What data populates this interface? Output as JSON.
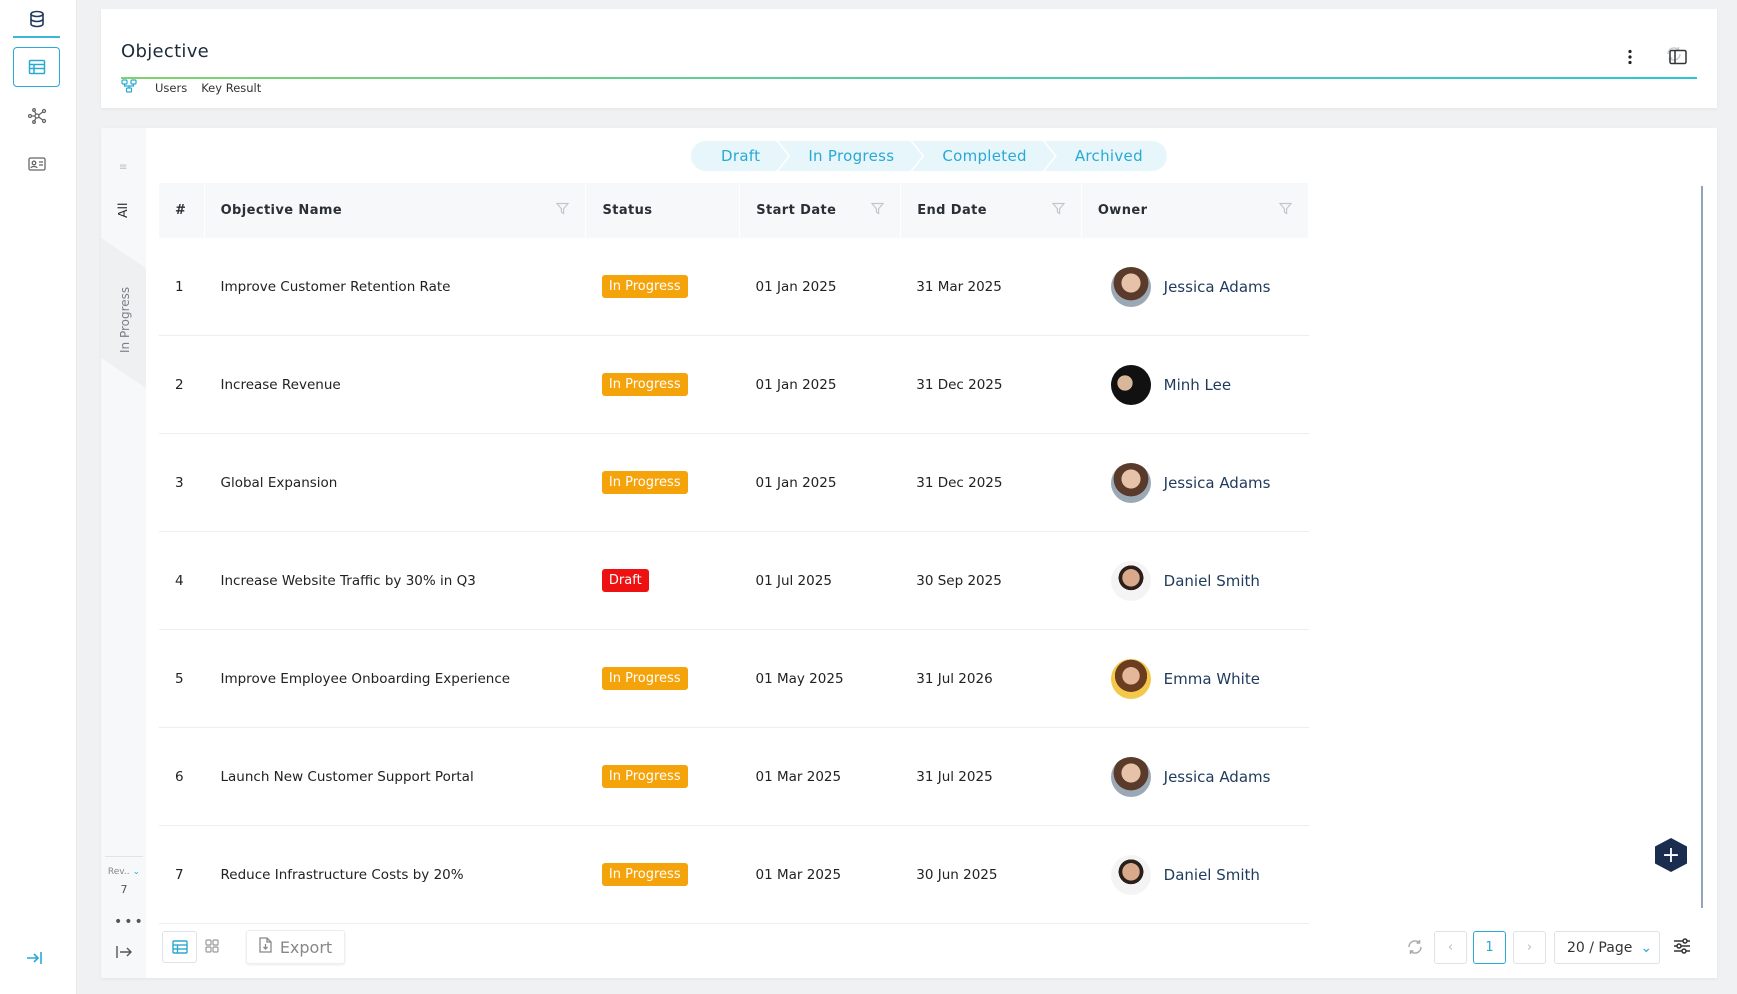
{
  "app": {
    "object_title": "Objective",
    "subnav": [
      "Users",
      "Key Result"
    ]
  },
  "pipeline": [
    "Draft",
    "In Progress",
    "Completed",
    "Archived"
  ],
  "side_filters": {
    "all": "All",
    "in_progress": "In Progress",
    "rev_label": "Rev..",
    "rev_count": "7"
  },
  "table": {
    "columns": [
      "#",
      "Objective Name",
      "Status",
      "Start Date",
      "End Date",
      "Owner"
    ],
    "rows": [
      {
        "num": "1",
        "name": "Improve Customer Retention Rate",
        "status": "In Progress",
        "start": "01 Jan 2025",
        "end": "31 Mar 2025",
        "owner": "Jessica Adams"
      },
      {
        "num": "2",
        "name": "Increase Revenue",
        "status": "In Progress",
        "start": "01 Jan 2025",
        "end": "31 Dec 2025",
        "owner": "Minh Lee"
      },
      {
        "num": "3",
        "name": "Global Expansion",
        "status": "In Progress",
        "start": "01 Jan 2025",
        "end": "31 Dec 2025",
        "owner": "Jessica Adams"
      },
      {
        "num": "4",
        "name": "Increase Website Traffic by 30% in Q3",
        "status": "Draft",
        "start": "01 Jul 2025",
        "end": "30 Sep 2025",
        "owner": "Daniel Smith"
      },
      {
        "num": "5",
        "name": "Improve Employee Onboarding Experience",
        "status": "In Progress",
        "start": "01 May 2025",
        "end": "31 Jul 2026",
        "owner": "Emma White"
      },
      {
        "num": "6",
        "name": "Launch New Customer Support Portal",
        "status": "In Progress",
        "start": "01 Mar 2025",
        "end": "31 Jul 2025",
        "owner": "Jessica Adams"
      },
      {
        "num": "7",
        "name": "Reduce Infrastructure Costs by 20%",
        "status": "In Progress",
        "start": "01 Mar 2025",
        "end": "30 Jun 2025",
        "owner": "Daniel Smith"
      }
    ]
  },
  "status_colors": {
    "In Progress": "#f5a30a",
    "Draft": "#ee1111"
  },
  "footer": {
    "export_label": "Export",
    "current_page": "1",
    "page_size": "20 / Page"
  }
}
